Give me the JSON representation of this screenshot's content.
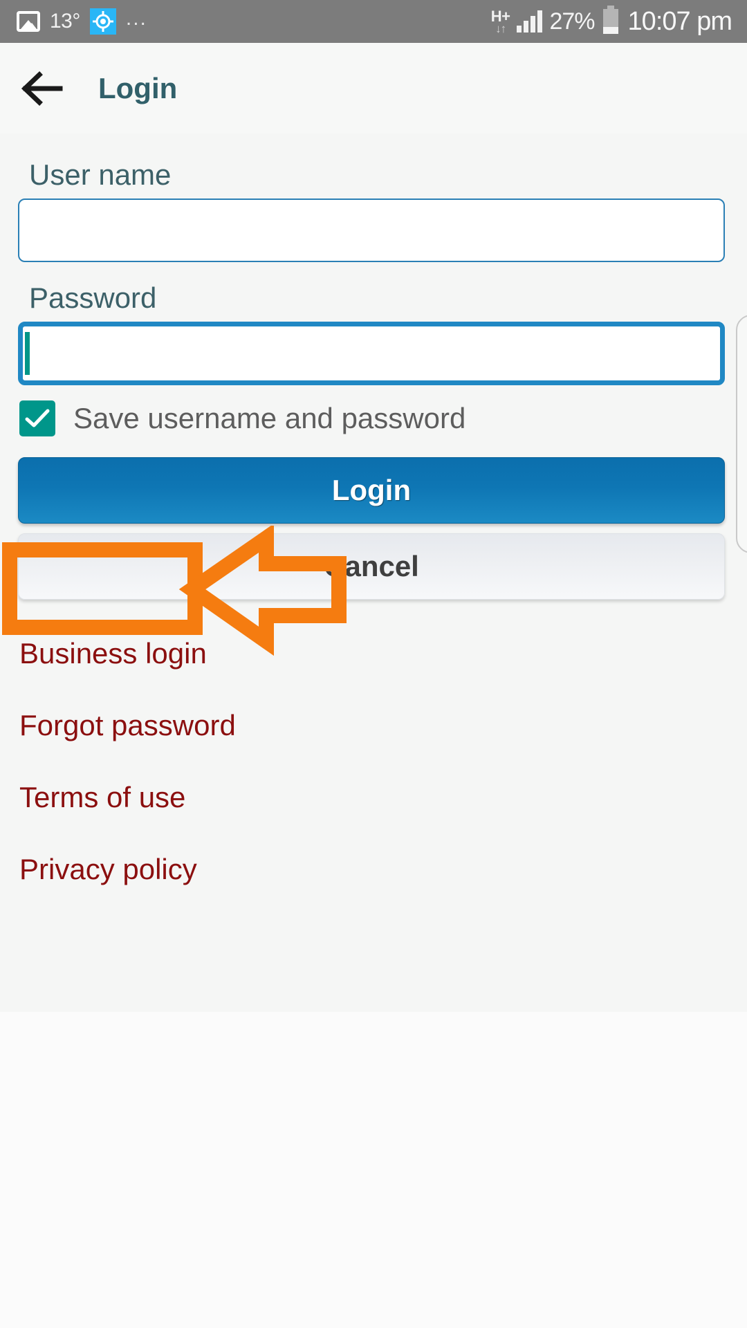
{
  "status_bar": {
    "background_color": "#7c7c7c",
    "photo_icon": "photo-icon",
    "temperature": "13°",
    "gps_icon": "gps-location-icon",
    "overflow_dots": "...",
    "network_type": "H+",
    "network_arrows": "↓↑",
    "signal_icon": "signal-bars-icon",
    "battery_percent": "27%",
    "battery_icon": "battery-icon",
    "clock": "10:07 pm"
  },
  "header": {
    "back_icon": "back-arrow-icon",
    "title": "Login",
    "title_color": "#31606a"
  },
  "form": {
    "username": {
      "label": "User name",
      "value": "",
      "placeholder": ""
    },
    "password": {
      "label": "Password",
      "value": "",
      "placeholder": ""
    },
    "save_credentials": {
      "label": "Save username and password",
      "checked": true,
      "check_icon": "checkmark-icon",
      "color": "#00968a"
    }
  },
  "buttons": {
    "login": "Login",
    "cancel": "Cancel",
    "login_color": "#0e76b4"
  },
  "links": [
    {
      "label": "Business login"
    },
    {
      "label": "Forgot password"
    },
    {
      "label": "Terms of use"
    },
    {
      "label": "Privacy policy"
    }
  ],
  "links_color": "#8b0f0f",
  "annotation": {
    "type": "highlight-box-and-arrow",
    "target_label": "Business login",
    "color": "#f57c10",
    "arrow_direction": "left"
  }
}
